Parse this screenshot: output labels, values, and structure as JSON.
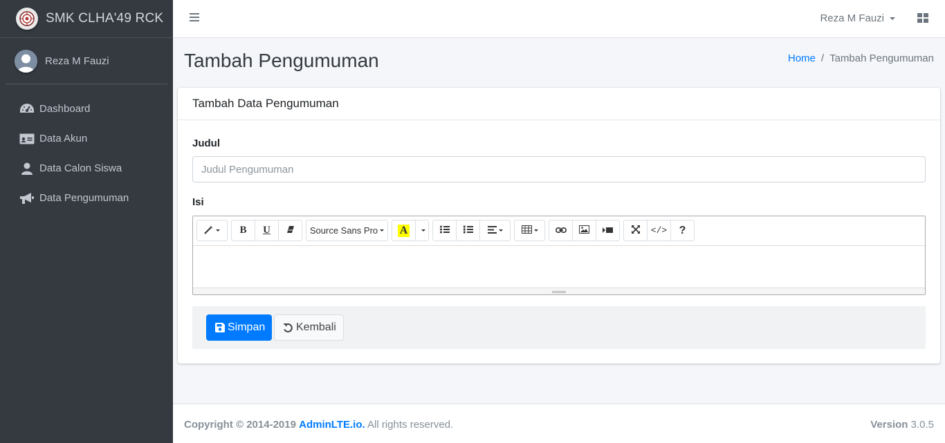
{
  "brand": {
    "name": "SMK CLHA'49 RCK"
  },
  "user": {
    "name": "Reza M Fauzi"
  },
  "sidebar": {
    "items": [
      {
        "label": "Dashboard",
        "icon": "tachometer-icon"
      },
      {
        "label": "Data Akun",
        "icon": "id-card-icon"
      },
      {
        "label": "Data Calon Siswa",
        "icon": "user-icon"
      },
      {
        "label": "Data Pengumuman",
        "icon": "bullhorn-icon"
      }
    ]
  },
  "header": {
    "user_name": "Reza M Fauzi"
  },
  "page": {
    "title": "Tambah Pengumuman",
    "breadcrumb": {
      "home": "Home",
      "current": "Tambah Pengumuman"
    }
  },
  "card": {
    "title": "Tambah Data Pengumuman",
    "judul_label": "Judul",
    "judul_placeholder": "Judul Pengumuman",
    "judul_value": "",
    "isi_label": "Isi",
    "editor": {
      "font_name": "Source Sans Pro",
      "toolbar_icons": [
        "magic-icon",
        "bold-icon",
        "underline-icon",
        "eraser-icon",
        "font-icon",
        "color-caret-icon",
        "unordered-list-icon",
        "ordered-list-icon",
        "align-icon",
        "table-icon",
        "link-icon",
        "picture-icon",
        "video-icon",
        "fullscreen-icon",
        "code-view-icon",
        "help-icon"
      ],
      "bold_glyph": "B",
      "underline_glyph": "U",
      "color_glyph": "A",
      "help_glyph": "?",
      "code_glyph": "</>"
    },
    "save_label": "Simpan",
    "back_label": "Kembali"
  },
  "footer": {
    "copyright_prefix": "Copyright © 2014-2019",
    "link": "AdminLTE.io.",
    "suffix": "All rights reserved.",
    "version_label": "Version",
    "version_number": "3.0.5"
  },
  "colors": {
    "sidebar": "#343a40",
    "primary": "#007bff",
    "background": "#f4f6f9",
    "highlight": "#ffff00"
  }
}
